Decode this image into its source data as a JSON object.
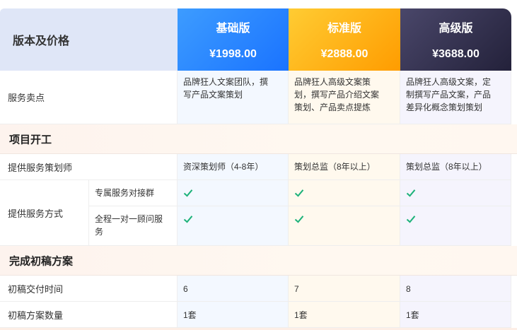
{
  "header": {
    "title": "版本及价格",
    "plans": [
      {
        "name": "基础版",
        "price": "¥1998.00"
      },
      {
        "name": "标准版",
        "price": "¥2888.00"
      },
      {
        "name": "高级版",
        "price": "¥3688.00"
      }
    ]
  },
  "selling_points": {
    "label": "服务卖点",
    "values": [
      [
        "品牌狂人文案团队，撰",
        "写产品文案策划"
      ],
      [
        "品牌狂人高级文案策",
        "划，撰写产品介绍文案",
        "策划、产品卖点提炼"
      ],
      [
        "品牌狂人高级文案，定",
        "制撰写产品文案，产品",
        "差异化概念策划策划"
      ]
    ]
  },
  "section1": {
    "title": "项目开工",
    "planner": {
      "label": "提供服务策划师",
      "values": [
        "资深策划师（4-8年）",
        "策划总监（8年以上）",
        "策划总监（8年以上）"
      ]
    },
    "service_mode": {
      "label": "提供服务方式",
      "sub1": "专属服务对接群",
      "sub2_line1": "全程一对一顾问服",
      "sub2_line2": "务"
    }
  },
  "section2": {
    "title": "完成初稿方案",
    "delivery_time": {
      "label": "初稿交付时间",
      "values": [
        "6",
        "7",
        "8"
      ]
    },
    "draft_count": {
      "label": "初稿方案数量",
      "values": [
        "1套",
        "1套",
        "1套"
      ]
    }
  },
  "colors": {
    "check": "#1db27a",
    "basic": "#1a73ff",
    "standard": "#ff9c00",
    "advanced": "#23213a"
  },
  "icons": {
    "included": "check-icon"
  }
}
